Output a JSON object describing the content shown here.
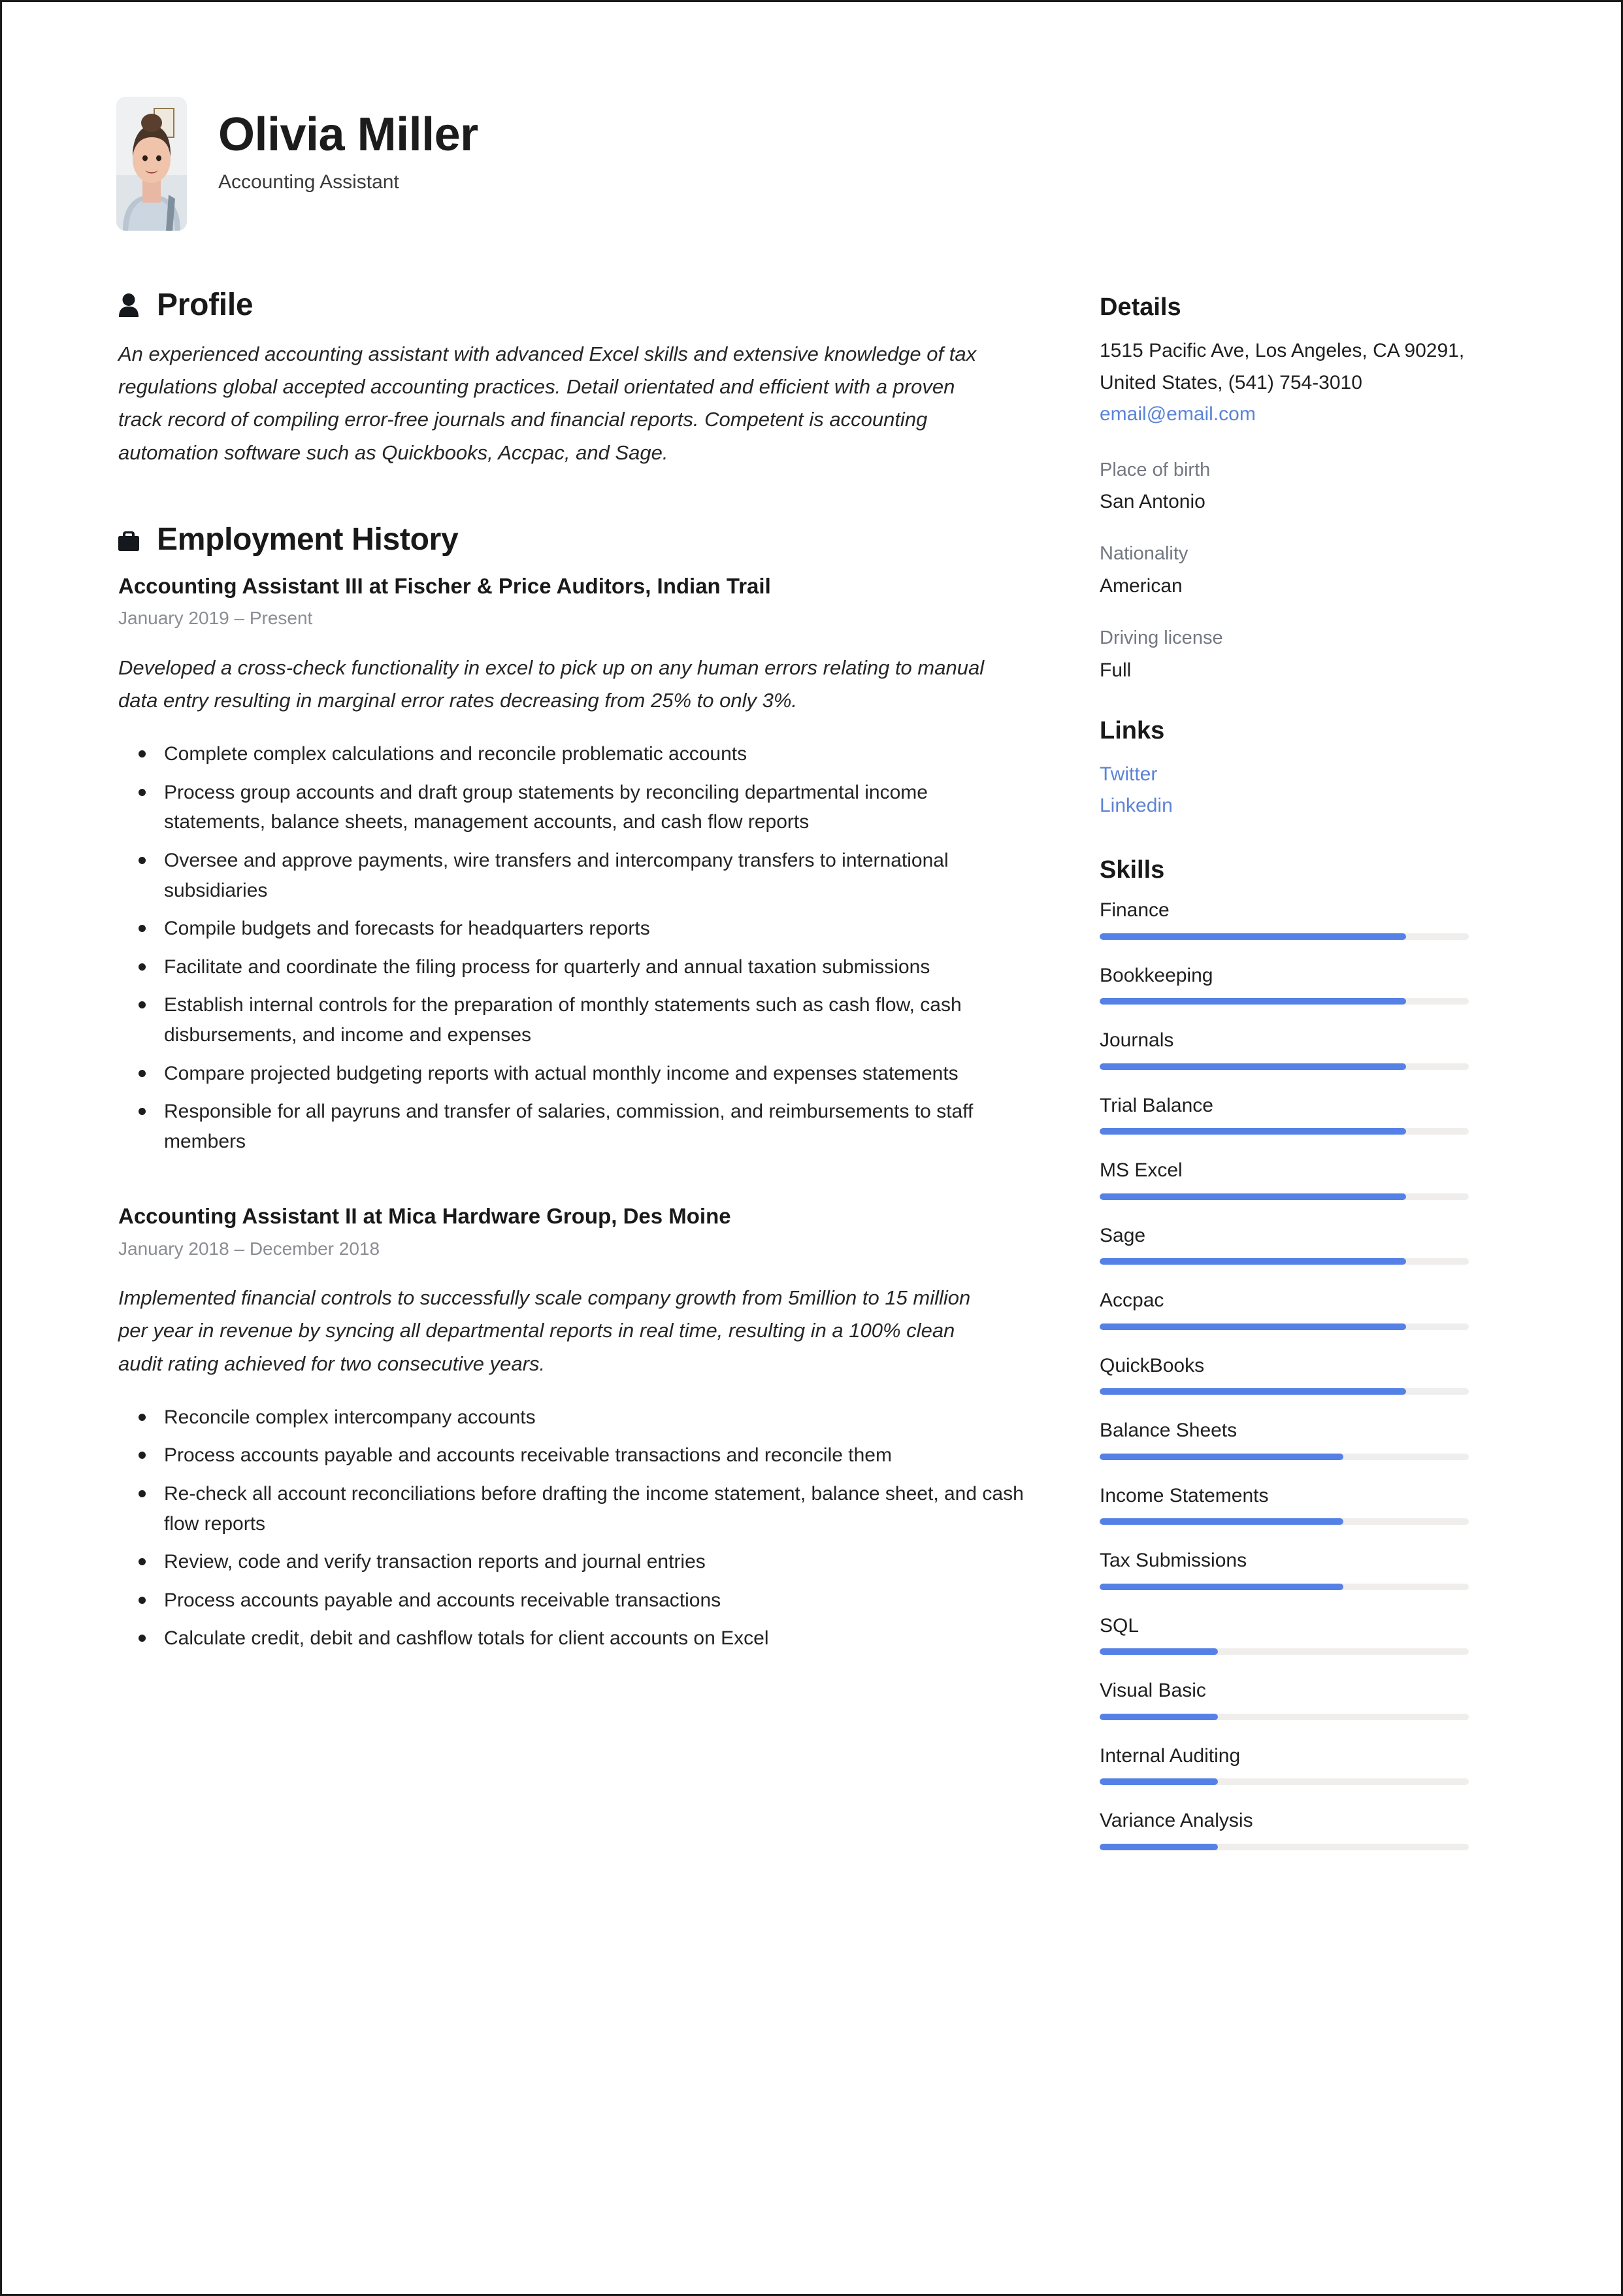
{
  "header": {
    "name": "Olivia Miller",
    "job_title": "Accounting Assistant",
    "avatar_alt": "portrait-photo"
  },
  "profile": {
    "heading": "Profile",
    "icon": "person-icon",
    "text": "An experienced accounting assistant with advanced Excel skills and extensive knowledge of tax regulations global accepted accounting practices. Detail orientated and efficient with a proven track record of compiling error-free journals and financial reports. Competent is accounting automation software such as Quickbooks, Accpac, and Sage."
  },
  "employment": {
    "heading": "Employment History",
    "icon": "briefcase-icon",
    "jobs": [
      {
        "title": "Accounting Assistant III at Fischer & Price Auditors, Indian Trail",
        "dates": "January 2019  –  Present",
        "summary": "Developed a cross-check functionality in excel to pick up on any human errors relating to manual data entry resulting in marginal error rates decreasing from 25% to only 3%.",
        "bullets": [
          "Complete complex calculations and reconcile problematic accounts",
          "Process group accounts and draft group statements by reconciling departmental income statements, balance sheets, management accounts, and cash flow reports",
          "Oversee and approve payments, wire transfers and intercompany transfers to international subsidiaries",
          "Compile budgets and forecasts for headquarters reports",
          "Facilitate and coordinate the filing process for quarterly and annual taxation submissions",
          "Establish internal controls for the preparation of monthly statements such as cash flow, cash disbursements, and income and expenses",
          "Compare projected budgeting reports with actual monthly income and expenses statements",
          "Responsible for all payruns and transfer of salaries, commission, and reimbursements to staff members"
        ]
      },
      {
        "title": "Accounting Assistant II at Mica Hardware Group, Des Moine",
        "dates": "January 2018  –  December 2018",
        "summary": "Implemented financial controls to successfully scale company growth from 5million to 15 million per year in revenue by syncing all departmental reports in real time, resulting in a 100% clean audit rating achieved for two consecutive years.",
        "bullets": [
          "Reconcile complex intercompany accounts",
          "Process accounts payable and accounts receivable transactions and reconcile them",
          "Re-check all account reconciliations before drafting the income statement, balance sheet, and cash flow reports",
          "Review, code and verify transaction reports and journal entries",
          "Process accounts payable and accounts receivable transactions",
          "Calculate credit, debit and cashflow totals for client accounts on Excel"
        ]
      }
    ]
  },
  "details": {
    "heading": "Details",
    "address": "1515 Pacific Ave, Los Angeles, CA 90291, United States, (541) 754-3010",
    "email": "email@email.com",
    "fields": [
      {
        "label": "Place of birth",
        "value": "San Antonio"
      },
      {
        "label": "Nationality",
        "value": "American"
      },
      {
        "label": "Driving license",
        "value": "Full"
      }
    ]
  },
  "links": {
    "heading": "Links",
    "items": [
      {
        "label": "Twitter"
      },
      {
        "label": "Linkedin"
      }
    ]
  },
  "skills": {
    "heading": "Skills",
    "accent_color": "#5581e6",
    "track_color": "#efeeec",
    "items": [
      {
        "name": "Finance",
        "level": 83
      },
      {
        "name": "Bookkeeping",
        "level": 83
      },
      {
        "name": "Journals",
        "level": 83
      },
      {
        "name": "Trial Balance",
        "level": 83
      },
      {
        "name": "MS Excel",
        "level": 83
      },
      {
        "name": "Sage",
        "level": 83
      },
      {
        "name": "Accpac",
        "level": 83
      },
      {
        "name": "QuickBooks",
        "level": 83
      },
      {
        "name": "Balance Sheets",
        "level": 66
      },
      {
        "name": "Income Statements",
        "level": 66
      },
      {
        "name": "Tax Submissions",
        "level": 66
      },
      {
        "name": "SQL",
        "level": 32
      },
      {
        "name": "Visual Basic",
        "level": 32
      },
      {
        "name": "Internal Auditing",
        "level": 32
      },
      {
        "name": "Variance Analysis",
        "level": 32
      }
    ]
  }
}
